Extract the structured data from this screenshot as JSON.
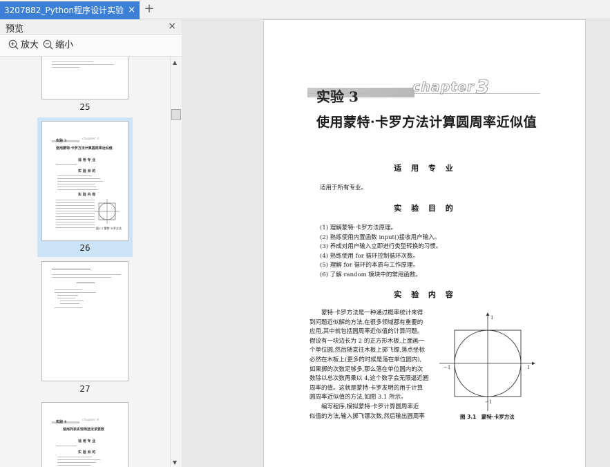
{
  "tabbar": {
    "tab_title": "3207882_Python程序设计实验",
    "tab_close": "×",
    "add_tab": "+"
  },
  "preview_panel": {
    "title": "预览",
    "close": "×",
    "zoom_in_label": "放大",
    "zoom_out_label": "缩小",
    "thumbnails": [
      {
        "page_number": "25",
        "selected": false
      },
      {
        "page_number": "26",
        "selected": true
      },
      {
        "page_number": "27",
        "selected": false
      },
      {
        "page_number": "",
        "selected": false
      }
    ],
    "thumb26": {
      "exp": "实验 3",
      "chapter": "chapter 3",
      "title": "使用蒙特·卡罗方法计算圆周率近似值",
      "h1": "适 用 专 业",
      "h2": "实 验 目 的",
      "h3": "实 验 内 容",
      "fig": "图3.1  蒙特·卡罗方法"
    },
    "thumb28": {
      "exp": "实验 4",
      "chapter": "chapter 4",
      "title": "使用列表实现筛选法求素数",
      "h1": "适 用 专 业",
      "h2": "实 验 目 的"
    }
  },
  "document": {
    "experiment_label": "实验 3",
    "chapter_word": "chapter",
    "chapter_number": "3",
    "title": "使用蒙特·卡罗方法计算圆周率近似值",
    "section_applicable": "适 用 专 业",
    "applicable_text": "适用于所有专业。",
    "section_goals": "实 验 目 的",
    "goals": [
      "(1) 理解蒙特·卡罗方法原理。",
      "(2) 熟练使用内置函数 input()接收用户输入。",
      "(3) 养成对用户输入立即进行类型转换的习惯。",
      "(4) 熟练使用 for 循环控制循环次数。",
      "(5) 理解 for 循环的本质与工作原理。",
      "(6) 了解 random 模块中的常用函数。"
    ],
    "section_content": "实 验 内 容",
    "content_lines": [
      "　　蒙特·卡罗方法是一种通过概率统计来得",
      "到问题近似解的方法,在很多领域都有重要的",
      "应用,其中就包括圆周率近似值的计算问题。",
      "假设有一块边长为 2 的正方形木板,上面画一",
      "个单位圆,然后随意往木板上掷飞镖,落点坐标",
      "必然在木板上(更多的时候是落在单位圆内),",
      "如果掷的次数足够多,那么落在单位圆内的次",
      "数除以总次数再乘以 4,这个数字会无限逼近圆",
      "周率的值。这就是蒙特·卡罗发明的用于计算",
      "圆周率近似值的方法,如图 3.1 所示。",
      "　　编写程序,模拟蒙特·卡罗计算圆周率近",
      "似值的方法,输入掷飞镖次数,然后输出圆周率"
    ],
    "figure": {
      "label_top": "1",
      "label_bottom": "−1",
      "label_left": "−1",
      "label_right": "1",
      "caption": "图 3.1　蒙特·卡罗方法"
    }
  }
}
